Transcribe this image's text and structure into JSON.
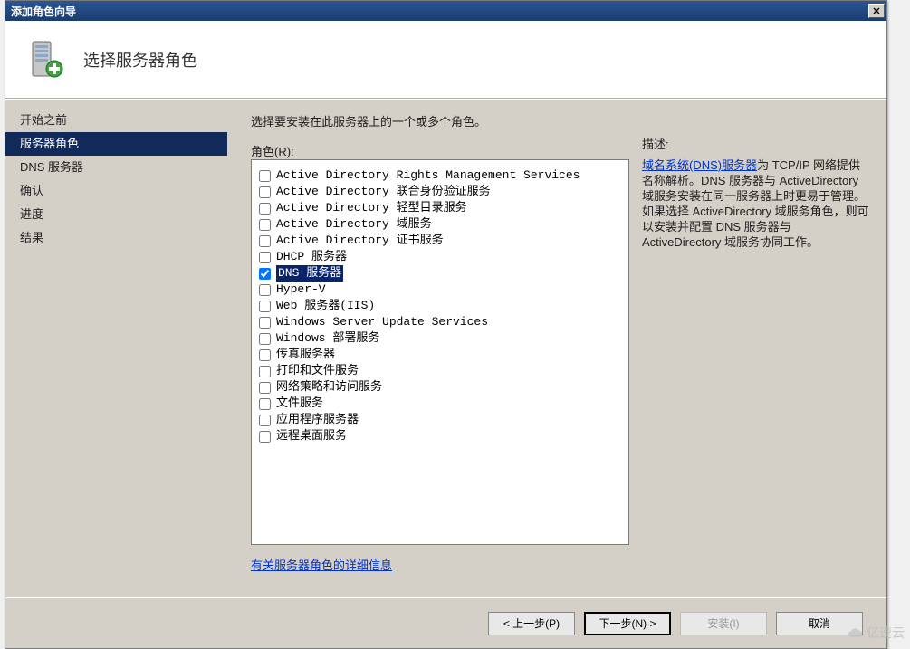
{
  "window": {
    "title": "添加角色向导"
  },
  "header": {
    "title": "选择服务器角色"
  },
  "sidebar": {
    "items": [
      {
        "label": "开始之前",
        "selected": false
      },
      {
        "label": "服务器角色",
        "selected": true
      },
      {
        "label": "DNS 服务器",
        "selected": false
      },
      {
        "label": "确认",
        "selected": false
      },
      {
        "label": "进度",
        "selected": false
      },
      {
        "label": "结果",
        "selected": false
      }
    ]
  },
  "main": {
    "instruction": "选择要安装在此服务器上的一个或多个角色。",
    "roles_label": "角色(R):",
    "roles": [
      {
        "label": "Active Directory Rights Management Services",
        "checked": false,
        "highlight": false
      },
      {
        "label": "Active Directory 联合身份验证服务",
        "checked": false,
        "highlight": false
      },
      {
        "label": "Active Directory 轻型目录服务",
        "checked": false,
        "highlight": false
      },
      {
        "label": "Active Directory 域服务",
        "checked": false,
        "highlight": false
      },
      {
        "label": "Active Directory 证书服务",
        "checked": false,
        "highlight": false
      },
      {
        "label": "DHCP 服务器",
        "checked": false,
        "highlight": false
      },
      {
        "label": "DNS 服务器",
        "checked": true,
        "highlight": true
      },
      {
        "label": "Hyper-V",
        "checked": false,
        "highlight": false
      },
      {
        "label": "Web 服务器(IIS)",
        "checked": false,
        "highlight": false
      },
      {
        "label": "Windows Server Update Services",
        "checked": false,
        "highlight": false
      },
      {
        "label": "Windows 部署服务",
        "checked": false,
        "highlight": false
      },
      {
        "label": "传真服务器",
        "checked": false,
        "highlight": false
      },
      {
        "label": "打印和文件服务",
        "checked": false,
        "highlight": false
      },
      {
        "label": "网络策略和访问服务",
        "checked": false,
        "highlight": false
      },
      {
        "label": "文件服务",
        "checked": false,
        "highlight": false
      },
      {
        "label": "应用程序服务器",
        "checked": false,
        "highlight": false
      },
      {
        "label": "远程桌面服务",
        "checked": false,
        "highlight": false
      }
    ],
    "more_info": "有关服务器角色的详细信息",
    "description": {
      "title": "描述:",
      "link_text": "域名系统(DNS)服务器",
      "body": "为 TCP/IP 网络提供名称解析。DNS 服务器与 ActiveDirectory 域服务安装在同一服务器上时更易于管理。如果选择 ActiveDirectory 域服务角色，则可以安装并配置 DNS 服务器与 ActiveDirectory 域服务协同工作。"
    }
  },
  "buttons": {
    "back": "< 上一步(P)",
    "next_pre": "下一步(N) >",
    "install": "安装(I)",
    "cancel": "取消"
  },
  "watermark": {
    "text": "亿速云"
  }
}
